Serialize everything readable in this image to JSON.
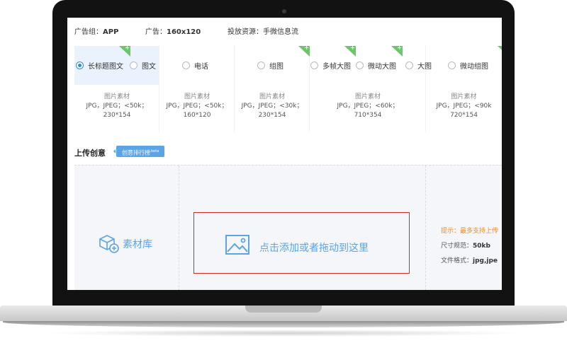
{
  "info": {
    "group_label": "广告组：",
    "group_value": "APP",
    "ad_label": "广告：",
    "ad_value": "160x120",
    "resource_label": "投放资源：",
    "resource_value": "手微信息流"
  },
  "types": [
    {
      "label": "长标题图文",
      "selected": true,
      "new": true,
      "spec_title": "图片素材",
      "spec_format": "JPG，JPEG；<50k；",
      "spec_size": "230*154"
    },
    {
      "label": "图文",
      "selected": false,
      "new": false,
      "spec_title": "图片素材",
      "spec_format": "JPG，JPEG；<50k；",
      "spec_size": "160*120"
    },
    {
      "label": "电话",
      "selected": false,
      "new": false,
      "spec_title": "",
      "spec_format": "",
      "spec_size": ""
    },
    {
      "label": "组图",
      "selected": false,
      "new": true,
      "spec_title": "图片素材",
      "spec_format": "JPG，JPEG；<30k；",
      "spec_size": "230*154"
    },
    {
      "label": "多帧大图",
      "selected": false,
      "new": true,
      "spec_title": "",
      "spec_format": "",
      "spec_size": ""
    },
    {
      "label": "微动大图",
      "selected": false,
      "new": true,
      "spec_title": "图片素材",
      "spec_format": "JPG，JPEG；<60k；",
      "spec_size": "710*354"
    },
    {
      "label": "大图",
      "selected": false,
      "new": false,
      "spec_title": "",
      "spec_format": "",
      "spec_size": ""
    },
    {
      "label": "微动组图",
      "selected": false,
      "new": true,
      "spec_title": "图片素材",
      "spec_format": "JPG，JPEG；<90k",
      "spec_size": "720*154"
    }
  ],
  "upload": {
    "title": "上传创意",
    "rank_button": "创意排行榜",
    "rank_badge": "beta",
    "library_label": "素材库",
    "drop_label": "点击添加或者拖动到这里",
    "hint": "提示：最多支持上传",
    "size_label": "尺寸规范：",
    "size_value": "50kb",
    "format_label": "文件格式：",
    "format_value": "jpg,jpe"
  },
  "colors": {
    "accent": "#5ba4e5",
    "selected_bg": "#eaf3fd",
    "new_flag": "#6cc46b",
    "drop_border": "#d9282a",
    "hint": "#f08a24"
  }
}
